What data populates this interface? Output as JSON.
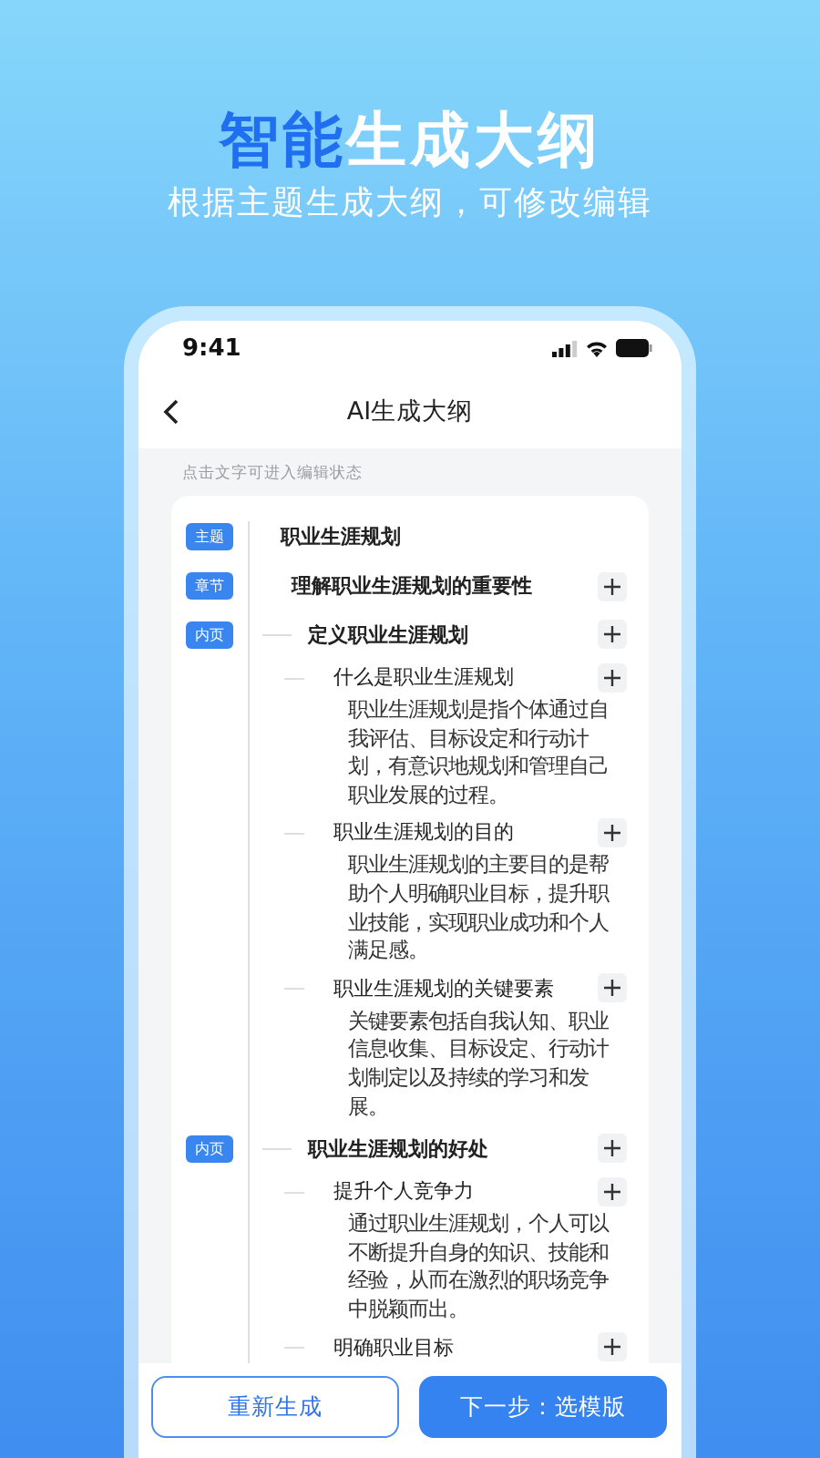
{
  "banner": {
    "title_parts": [
      {
        "text": "智能",
        "highlight": true
      },
      {
        "text": "生成大纲",
        "highlight": false
      }
    ],
    "subtitle": "根据主题生成大纲，可修改编辑"
  },
  "status_bar": {
    "time": "9:41"
  },
  "nav": {
    "title": "AI生成大纲"
  },
  "hint": "点击文字可进入编辑状态",
  "outline": [
    {
      "kind": "topic",
      "tag": "主题",
      "title": "职业生涯规划",
      "children": [
        {
          "kind": "chapter",
          "tag": "章节",
          "title": "理解职业生涯规划的重要性",
          "children": [
            {
              "kind": "page",
              "tag": "内页",
              "title": "定义职业生涯规划",
              "children": [
                {
                  "kind": "point",
                  "title": "什么是职业生涯规划",
                  "text": "职业生涯规划是指个体通过自我评估、目标设定和行动计划，有意识地规划和管理自己职业发展的过程。"
                },
                {
                  "kind": "point",
                  "title": "职业生涯规划的目的",
                  "text": "职业生涯规划的主要目的是帮助个人明确职业目标，提升职业技能，实现职业成功和个人满足感。"
                },
                {
                  "kind": "point",
                  "title": "职业生涯规划的关键要素",
                  "text": "关键要素包括自我认知、职业信息收集、目标设定、行动计划制定以及持续的学习和发展。"
                }
              ]
            },
            {
              "kind": "page",
              "tag": "内页",
              "title": "职业生涯规划的好处",
              "children": [
                {
                  "kind": "point",
                  "title": "提升个人竞争力",
                  "text": "通过职业生涯规划，个人可以不断提升自身的知识、技能和经验，从而在激烈的职场竞争中脱颖而出。"
                },
                {
                  "kind": "point",
                  "title": "明确职业目标"
                }
              ]
            }
          ]
        }
      ]
    }
  ],
  "buttons": [
    {
      "label": "重新生成",
      "kind": "secondary"
    },
    {
      "label": "下一步：选模版",
      "kind": "primary"
    }
  ]
}
